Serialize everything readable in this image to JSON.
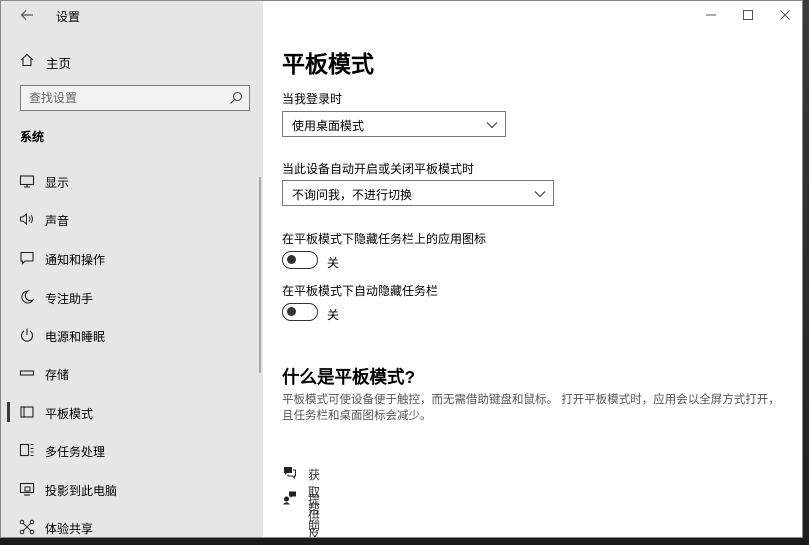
{
  "window": {
    "app_title": "设置",
    "controls": {
      "minimize": "—",
      "maximize": "☐",
      "close": "✕"
    }
  },
  "sidebar": {
    "home_label": "主页",
    "search_placeholder": "查找设置",
    "section_label": "系统",
    "items": [
      {
        "label": "显示",
        "icon": "monitor-icon"
      },
      {
        "label": "声音",
        "icon": "speaker-icon"
      },
      {
        "label": "通知和操作",
        "icon": "notification-icon"
      },
      {
        "label": "专注助手",
        "icon": "moon-icon"
      },
      {
        "label": "电源和睡眠",
        "icon": "power-icon"
      },
      {
        "label": "存储",
        "icon": "storage-icon"
      },
      {
        "label": "平板模式",
        "icon": "tablet-mode-icon",
        "active": true
      },
      {
        "label": "多任务处理",
        "icon": "multitask-icon"
      },
      {
        "label": "投影到此电脑",
        "icon": "project-icon"
      },
      {
        "label": "体验共享",
        "icon": "share-icon"
      }
    ]
  },
  "main": {
    "title": "平板模式",
    "signin_label": "当我登录时",
    "signin_value": "使用桌面模式",
    "auto_switch_label": "当此设备自动开启或关闭平板模式时",
    "auto_switch_value": "不询问我，不进行切换",
    "hide_icons_label": "在平板模式下隐藏任务栏上的应用图标",
    "hide_icons_state": "关",
    "auto_hide_label": "在平板模式下自动隐藏任务栏",
    "auto_hide_state": "关",
    "about_title": "什么是平板模式?",
    "about_desc": "平板模式可使设备便于触控，而无需借助键盘和鼠标。 打开平板模式时，应用会以全屏方式打开，且任务栏和桌面图标会减少。",
    "help_link": "获取帮助",
    "feedback_link": "提供反馈"
  }
}
